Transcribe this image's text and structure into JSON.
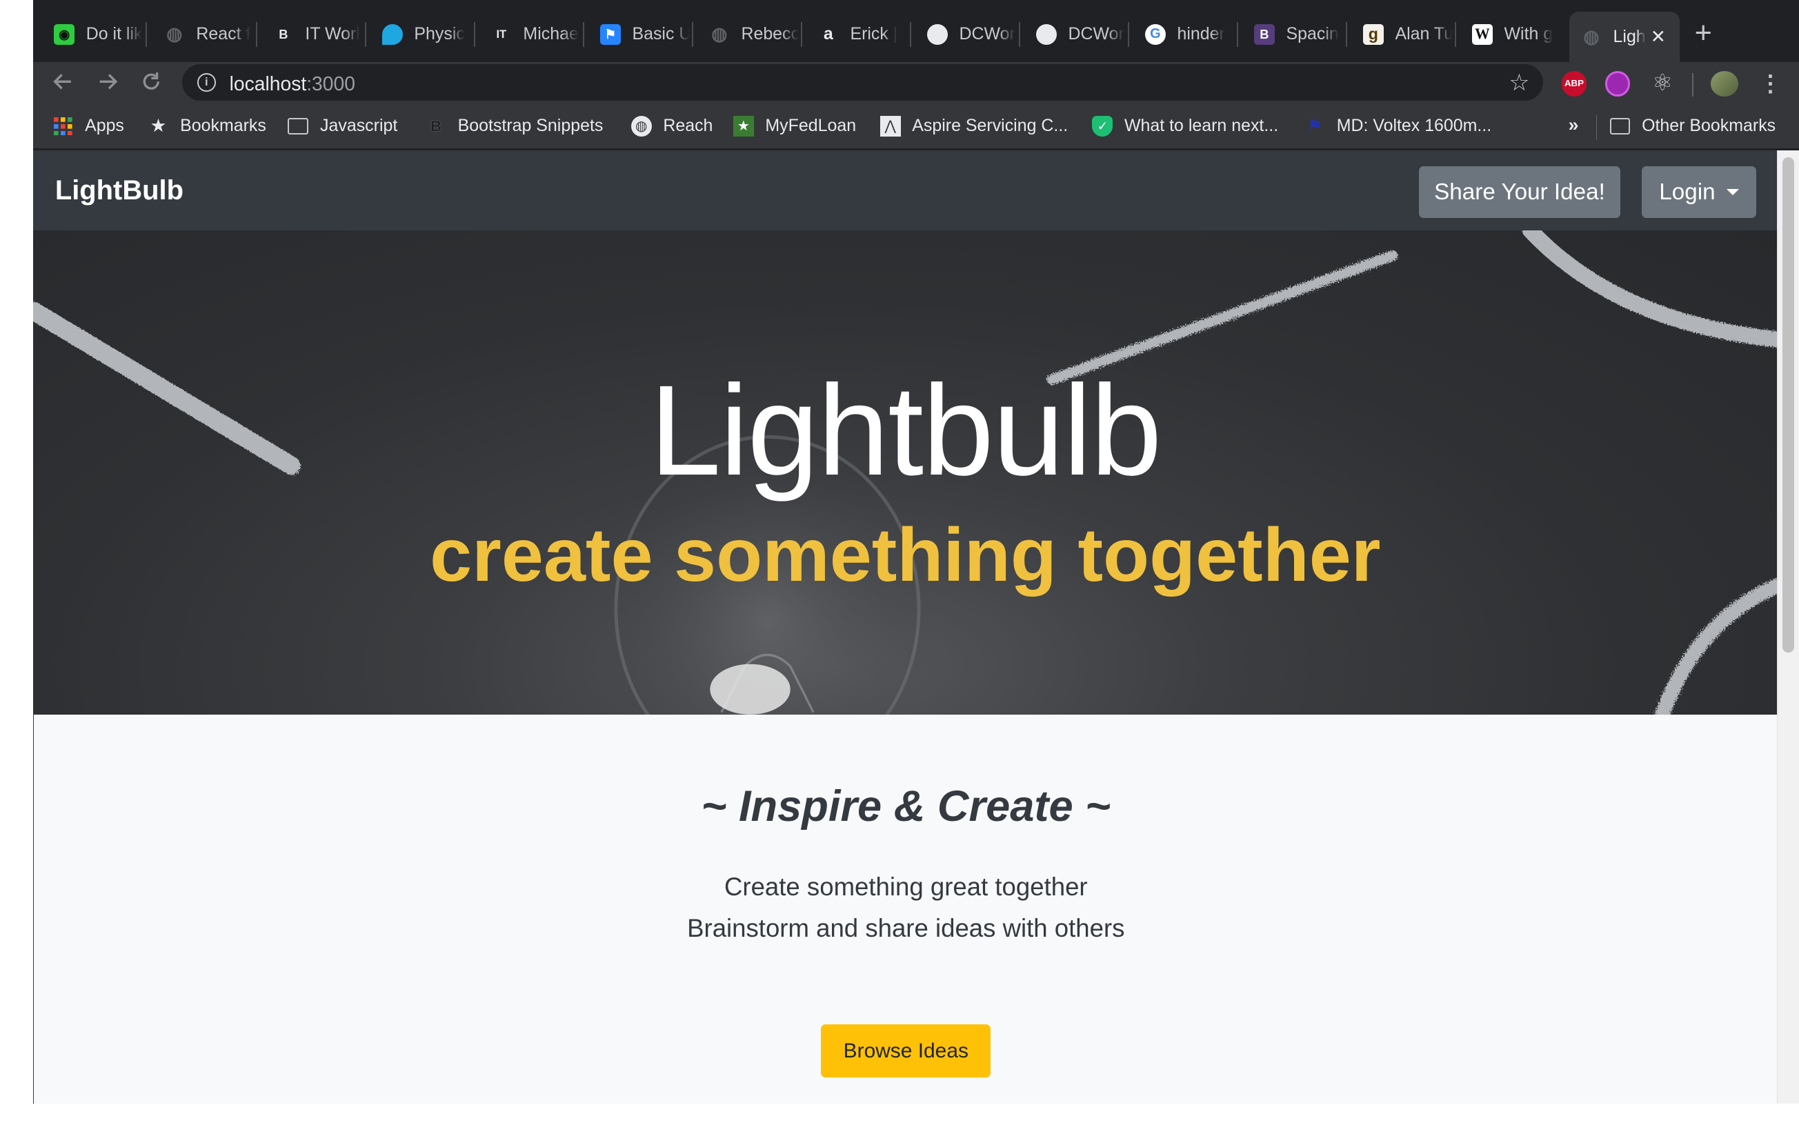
{
  "browser": {
    "tabs": [
      {
        "title": "Do it lik",
        "icon": "green-app-icon"
      },
      {
        "title": "React f",
        "icon": "globe-icon"
      },
      {
        "title": "IT Worl",
        "icon": "b-letter-icon"
      },
      {
        "title": "Physic",
        "icon": "bubble-icon"
      },
      {
        "title": "Michae",
        "icon": "it-letter-icon"
      },
      {
        "title": "Basic U",
        "icon": "flag-icon"
      },
      {
        "title": "Rebecc",
        "icon": "globe-icon"
      },
      {
        "title": "Erick |",
        "icon": "amazon-a-icon"
      },
      {
        "title": "DCWor",
        "icon": "github-icon"
      },
      {
        "title": "DCWor",
        "icon": "github-icon"
      },
      {
        "title": "hinder",
        "icon": "google-icon"
      },
      {
        "title": "Spacin",
        "icon": "bootstrap-icon"
      },
      {
        "title": "Alan Tu",
        "icon": "goodreads-icon"
      },
      {
        "title": "With g",
        "icon": "wikipedia-icon"
      },
      {
        "title": "Ligh",
        "icon": "globe-icon",
        "active": true
      }
    ],
    "close_glyph": "✕",
    "new_tab_glyph": "+",
    "url_host": "localhost",
    "url_port": ":3000",
    "bookmarks": [
      {
        "label": "Apps",
        "icon": "apps-grid-icon"
      },
      {
        "label": "Bookmarks",
        "icon": "star-icon"
      },
      {
        "label": "Javascript",
        "icon": "folder-icon"
      },
      {
        "label": "Bootstrap Snippets",
        "icon": "b-letter-icon"
      },
      {
        "label": "Reach",
        "icon": "globe-icon"
      },
      {
        "label": "MyFedLoan",
        "icon": "star-badge-icon"
      },
      {
        "label": "Aspire Servicing C...",
        "icon": "mountain-icon"
      },
      {
        "label": "What to learn next...",
        "icon": "shield-icon"
      },
      {
        "label": "MD: Voltex 1600m...",
        "icon": "flag-icon"
      }
    ],
    "more_bookmarks": "»",
    "other_bookmarks": "Other Bookmarks",
    "extensions": [
      "abp-icon",
      "purple-ext-icon",
      "react-devtools-icon",
      "profile-avatar"
    ],
    "abp_label": "ABP"
  },
  "site": {
    "brand": "LightBulb",
    "share_button": "Share Your Idea!",
    "login_button": "Login",
    "hero_title": "Lightbulb",
    "hero_subtitle": "create something together",
    "section_heading": "~ Inspire & Create ~",
    "description": "Create something great together Brainstorm and share ideas with others",
    "browse_button": "Browse Ideas"
  },
  "colors": {
    "navbar": "#343a40",
    "secondary_button": "#6c757d",
    "accent_yellow": "#ffc107",
    "subtitle_yellow": "#f0c13f",
    "page_bg": "#f8f9fa"
  }
}
